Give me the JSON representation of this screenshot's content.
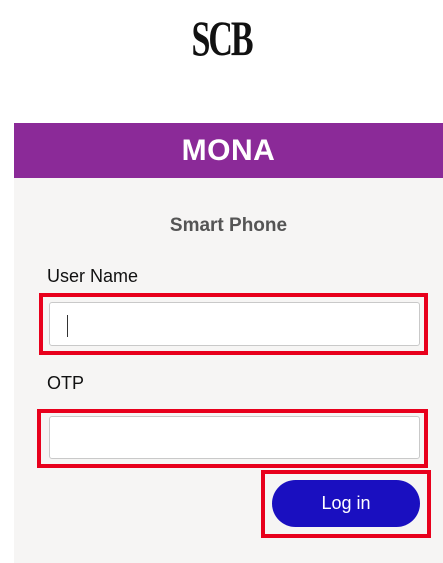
{
  "brand": {
    "logo_text": "SCB"
  },
  "card": {
    "header_title": "MONA",
    "subtitle": "Smart Phone",
    "accent_color": "#8b2a98"
  },
  "form": {
    "username": {
      "label": "User Name",
      "value": "",
      "placeholder": ""
    },
    "otp": {
      "label": "OTP",
      "value": "",
      "placeholder": ""
    },
    "login_button": {
      "label": "Log in",
      "color": "#1a0fc0"
    }
  },
  "highlight_color": "#e8001c"
}
